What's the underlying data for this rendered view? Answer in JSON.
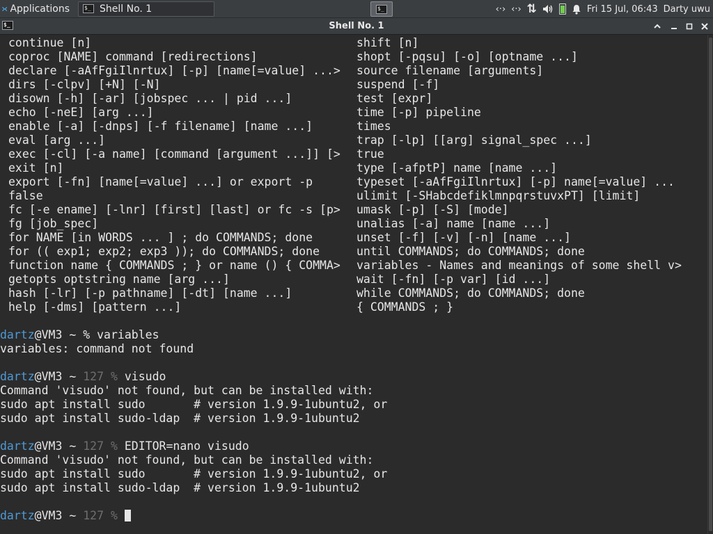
{
  "panel": {
    "apps_label": "Applications",
    "task_label": "Shell No. 1",
    "clock": "Fri 15 Jul, 06:43",
    "user": "Darty uwu",
    "tray_icons": [
      "network-icon",
      "network-icon",
      "transfer-icon",
      "volume-icon",
      "battery-icon",
      "notification-bell-icon"
    ],
    "net1_glyph": "‹·›",
    "net2_glyph": "‹·›",
    "transfer_glyph": "⇅",
    "volume_glyph": "🔈",
    "bell_glyph": "🔔"
  },
  "window": {
    "title": "Shell No. 1",
    "minimize_glyph": "▁",
    "maximize_glyph": "▢",
    "close_glyph": "✕",
    "shade_glyph": "⌃"
  },
  "terminal": {
    "help_left": [
      "continue [n]",
      "coproc [NAME] command [redirections]",
      "declare [-aAfFgiIlnrtux] [-p] [name[=value] ...>",
      "dirs [-clpv] [+N] [-N]",
      "disown [-h] [-ar] [jobspec ... | pid ...]",
      "echo [-neE] [arg ...]",
      "enable [-a] [-dnps] [-f filename] [name ...]",
      "eval [arg ...]",
      "exec [-cl] [-a name] [command [argument ...]] [>",
      "exit [n]",
      "export [-fn] [name[=value] ...] or export -p",
      "false",
      "fc [-e ename] [-lnr] [first] [last] or fc -s [p>",
      "fg [job_spec]",
      "for NAME [in WORDS ... ] ; do COMMANDS; done",
      "for (( exp1; exp2; exp3 )); do COMMANDS; done",
      "function name { COMMANDS ; } or name () { COMMA>",
      "getopts optstring name [arg ...]",
      "hash [-lr] [-p pathname] [-dt] [name ...]",
      "help [-dms] [pattern ...]"
    ],
    "help_right": [
      "shift [n]",
      "shopt [-pqsu] [-o] [optname ...]",
      "source filename [arguments]",
      "suspend [-f]",
      "test [expr]",
      "time [-p] pipeline",
      "times",
      "trap [-lp] [[arg] signal_spec ...]",
      "true",
      "type [-afptP] name [name ...]",
      "typeset [-aAfFgiIlnrtux] [-p] name[=value] ...",
      "ulimit [-SHabcdefiklmnpqrstuvxPT] [limit]",
      "umask [-p] [-S] [mode]",
      "unalias [-a] name [name ...]",
      "unset [-f] [-v] [-n] [name ...]",
      "until COMMANDS; do COMMANDS; done",
      "variables - Names and meanings of some shell v>",
      "wait [-fn] [-p var] [id ...]",
      "while COMMANDS; do COMMANDS; done",
      "{ COMMANDS ; }"
    ],
    "prompt_user": "dartz",
    "prompt_host": "@VM3 ~ ",
    "prompt_sym": "% ",
    "exit_code": "127 ",
    "cmd1": "variables",
    "out1": "variables: command not found",
    "cmd2": "visudo",
    "out2": [
      "Command 'visudo' not found, but can be installed with:",
      "sudo apt install sudo       # version 1.9.9-1ubuntu2, or",
      "sudo apt install sudo-ldap  # version 1.9.9-1ubuntu2"
    ],
    "cmd3": "EDITOR=nano visudo",
    "out3": [
      "Command 'visudo' not found, but can be installed with:",
      "sudo apt install sudo       # version 1.9.9-1ubuntu2, or",
      "sudo apt install sudo-ldap  # version 1.9.9-1ubuntu2"
    ]
  },
  "colors": {
    "terminal_bg": "#2b2b2b",
    "prompt_user": "#4e9ad6",
    "exit_code": "#6e6e6e",
    "panel_bg": "#3b3e41"
  }
}
